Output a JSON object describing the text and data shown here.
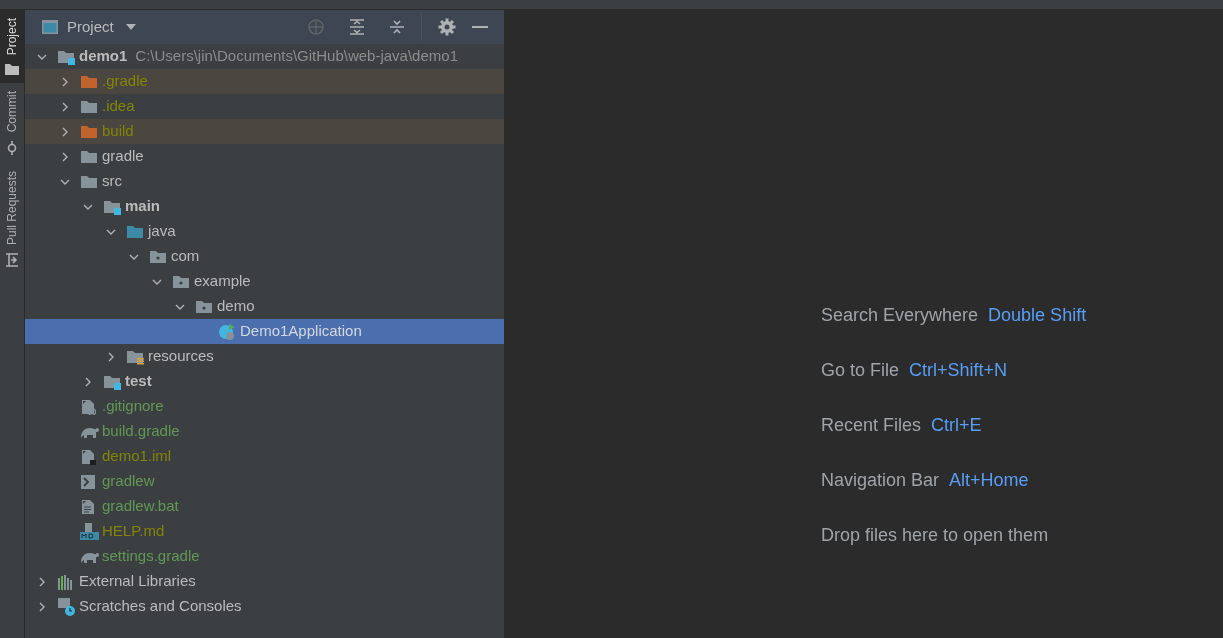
{
  "side_tabs": [
    {
      "label": "Project",
      "selected": true,
      "kind": "folder"
    },
    {
      "label": "Commit",
      "selected": false,
      "kind": "commit"
    },
    {
      "label": "Pull Requests",
      "selected": false,
      "kind": "pull"
    }
  ],
  "panel": {
    "title": "Project"
  },
  "tree": [
    {
      "label": "demo1",
      "path": "C:\\Users\\jin\\Documents\\GitHub\\web-java\\demo1",
      "kind": "module",
      "color": "#bbbbbb",
      "bold": true,
      "expanded": true,
      "selected": false,
      "excluded": false,
      "children": [
        {
          "label": ".gradle",
          "kind": "folder",
          "color": "#848504",
          "bold": false,
          "expanded": false,
          "selected": false,
          "excluded": true
        },
        {
          "label": ".idea",
          "kind": "folder",
          "color": "#848504",
          "bold": false,
          "expanded": false,
          "selected": false,
          "excluded": false
        },
        {
          "label": "build",
          "kind": "folder",
          "color": "#848504",
          "bold": false,
          "expanded": false,
          "selected": false,
          "excluded": true
        },
        {
          "label": "gradle",
          "kind": "folder",
          "color": "#bbbbbb",
          "bold": false,
          "expanded": false,
          "selected": false,
          "excluded": false
        },
        {
          "label": "src",
          "kind": "folder",
          "color": "#bbbbbb",
          "bold": false,
          "expanded": true,
          "selected": false,
          "excluded": false,
          "children": [
            {
              "label": "main",
              "kind": "module",
              "color": "#bbbbbb",
              "bold": true,
              "expanded": true,
              "selected": false,
              "excluded": false,
              "children": [
                {
                  "label": "java",
                  "kind": "source",
                  "color": "#bbbbbb",
                  "bold": false,
                  "expanded": true,
                  "selected": false,
                  "excluded": false,
                  "children": [
                    {
                      "label": "com",
                      "kind": "package",
                      "color": "#bbbbbb",
                      "bold": false,
                      "expanded": true,
                      "selected": false,
                      "excluded": false,
                      "children": [
                        {
                          "label": "example",
                          "kind": "package",
                          "color": "#bbbbbb",
                          "bold": false,
                          "expanded": true,
                          "selected": false,
                          "excluded": false,
                          "children": [
                            {
                              "label": "demo",
                              "kind": "package",
                              "color": "#bbbbbb",
                              "bold": false,
                              "expanded": true,
                              "selected": false,
                              "excluded": false,
                              "children": [
                                {
                                  "label": "Demo1Application",
                                  "kind": "app",
                                  "bold": false,
                                  "selected": true,
                                  "excluded": false
                                }
                              ]
                            }
                          ]
                        }
                      ]
                    }
                  ]
                },
                {
                  "label": "resources",
                  "kind": "resources",
                  "color": "#bbbbbb",
                  "bold": false,
                  "expanded": false,
                  "selected": false,
                  "excluded": false
                }
              ]
            },
            {
              "label": "test",
              "kind": "module",
              "color": "#bbbbbb",
              "bold": true,
              "expanded": false,
              "selected": false,
              "excluded": false
            }
          ]
        },
        {
          "label": ".gitignore",
          "kind": "ignorefile",
          "color": "#629755",
          "bold": false,
          "selected": false,
          "excluded": false
        },
        {
          "label": "build.gradle",
          "kind": "gradle",
          "color": "#629755",
          "bold": false,
          "selected": false,
          "excluded": false
        },
        {
          "label": "demo1.iml",
          "kind": "iml",
          "color": "#848504",
          "bold": false,
          "selected": false,
          "excluded": false
        },
        {
          "label": "gradlew",
          "kind": "script",
          "color": "#629755",
          "bold": false,
          "selected": false,
          "excluded": false
        },
        {
          "label": "gradlew.bat",
          "kind": "text",
          "color": "#629755",
          "bold": false,
          "selected": false,
          "excluded": false
        },
        {
          "label": "HELP.md",
          "kind": "markdown",
          "color": "#848504",
          "bold": false,
          "selected": false,
          "excluded": false
        },
        {
          "label": "settings.gradle",
          "kind": "gradle",
          "color": "#629755",
          "bold": false,
          "selected": false,
          "excluded": false
        }
      ]
    },
    {
      "label": "External Libraries",
      "kind": "libraries",
      "color": "#bbbbbb",
      "bold": false,
      "expanded": false,
      "selected": false,
      "excluded": false
    },
    {
      "label": "Scratches and Consoles",
      "kind": "scratches",
      "color": "#bbbbbb",
      "bold": false,
      "expanded": false,
      "selected": false,
      "excluded": false
    }
  ],
  "hints": [
    {
      "kind": "shortcut",
      "label": "Search Everywhere",
      "shortcut": "Double Shift"
    },
    {
      "kind": "shortcut",
      "label": "Go to File",
      "shortcut": "Ctrl+Shift+N"
    },
    {
      "kind": "shortcut",
      "label": "Recent Files",
      "shortcut": "Ctrl+E"
    },
    {
      "kind": "shortcut",
      "label": "Navigation Bar",
      "shortcut": "Alt+Home"
    },
    {
      "kind": "note",
      "label": "Drop files here to open them"
    }
  ]
}
